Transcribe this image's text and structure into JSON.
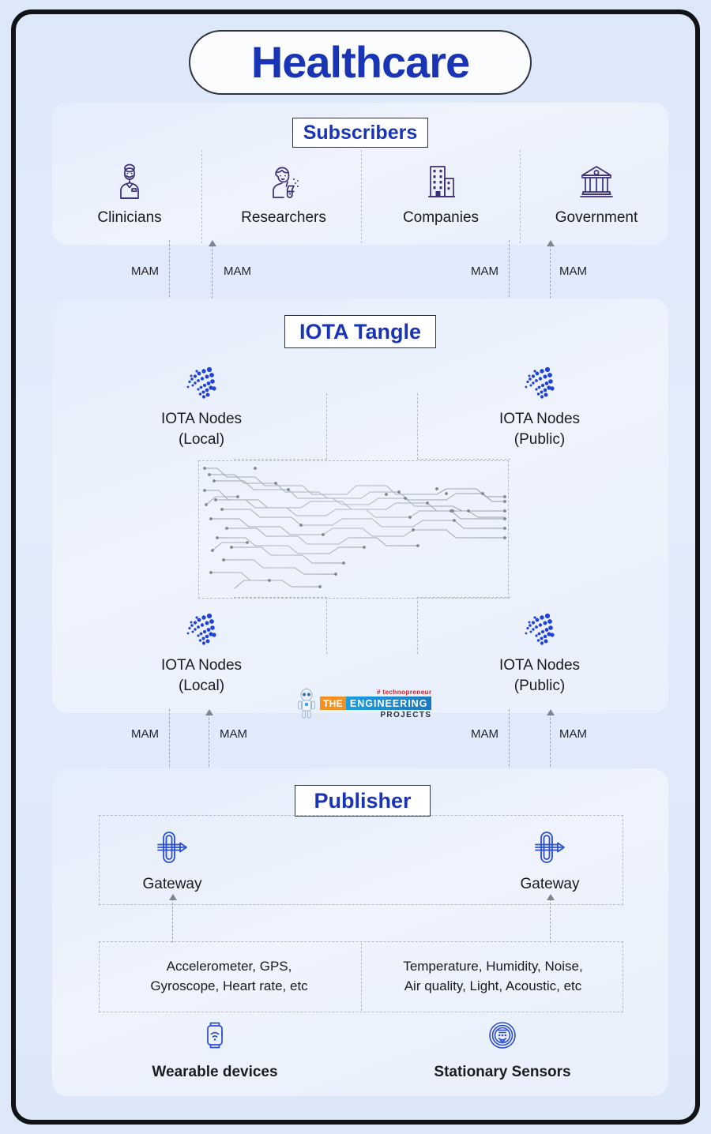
{
  "page": {
    "title": "Healthcare",
    "accent_blue": "#1934b5",
    "frame_border": "#111417",
    "background": "#dde8f9"
  },
  "subscribers": {
    "band_title": "Subscribers",
    "items": [
      {
        "label": "Clinicians",
        "icon": "clinician-icon"
      },
      {
        "label": "Researchers",
        "icon": "researcher-icon"
      },
      {
        "label": "Companies",
        "icon": "company-building-icon"
      },
      {
        "label": "Government",
        "icon": "government-bank-icon"
      }
    ]
  },
  "mam_top": {
    "labels": [
      "MAM",
      "MAM",
      "MAM",
      "MAM"
    ],
    "directions": [
      "down",
      "up",
      "down",
      "up"
    ]
  },
  "iota": {
    "band_title": "IOTA Tangle",
    "nodes_top": [
      {
        "label_line1": "IOTA Nodes",
        "label_line2": "(Local)",
        "icon": "iota-logo-icon"
      },
      {
        "label_line1": "IOTA Nodes",
        "label_line2": "(Public)",
        "icon": "iota-logo-icon"
      }
    ],
    "nodes_bottom": [
      {
        "label_line1": "IOTA Nodes",
        "label_line2": "(Local)",
        "icon": "iota-logo-icon"
      },
      {
        "label_line1": "IOTA Nodes",
        "label_line2": "(Public)",
        "icon": "iota-logo-icon"
      }
    ],
    "tangle_graphic": "circuit-tangle-graphic"
  },
  "watermark": {
    "hashtag": "# technopreneur",
    "the": "THE",
    "engineering": "ENGINEERING",
    "projects": "PROJECTS",
    "robot_icon": "robot-mascot-icon",
    "colors": {
      "the_bg": "#f39221",
      "eng_bg": "#1b9fe0",
      "hash": "#d8232a"
    }
  },
  "mam_bottom": {
    "labels": [
      "MAM",
      "MAM",
      "MAM",
      "MAM"
    ],
    "directions": [
      "down",
      "up",
      "down",
      "up"
    ]
  },
  "publisher": {
    "band_title": "Publisher",
    "gateways": [
      {
        "label": "Gateway",
        "icon": "gateway-icon"
      },
      {
        "label": "Gateway",
        "icon": "gateway-icon"
      }
    ],
    "sensor_lists": [
      {
        "line1": "Accelerometer, GPS,",
        "line2": "Gyroscope, Heart rate, etc"
      },
      {
        "line1": "Temperature, Humidity, Noise,",
        "line2": "Air quality, Light, Acoustic, etc"
      }
    ],
    "devices": [
      {
        "label": "Wearable devices",
        "icon": "smartwatch-icon"
      },
      {
        "label": "Stationary Sensors",
        "icon": "sensor-disc-icon"
      }
    ]
  }
}
